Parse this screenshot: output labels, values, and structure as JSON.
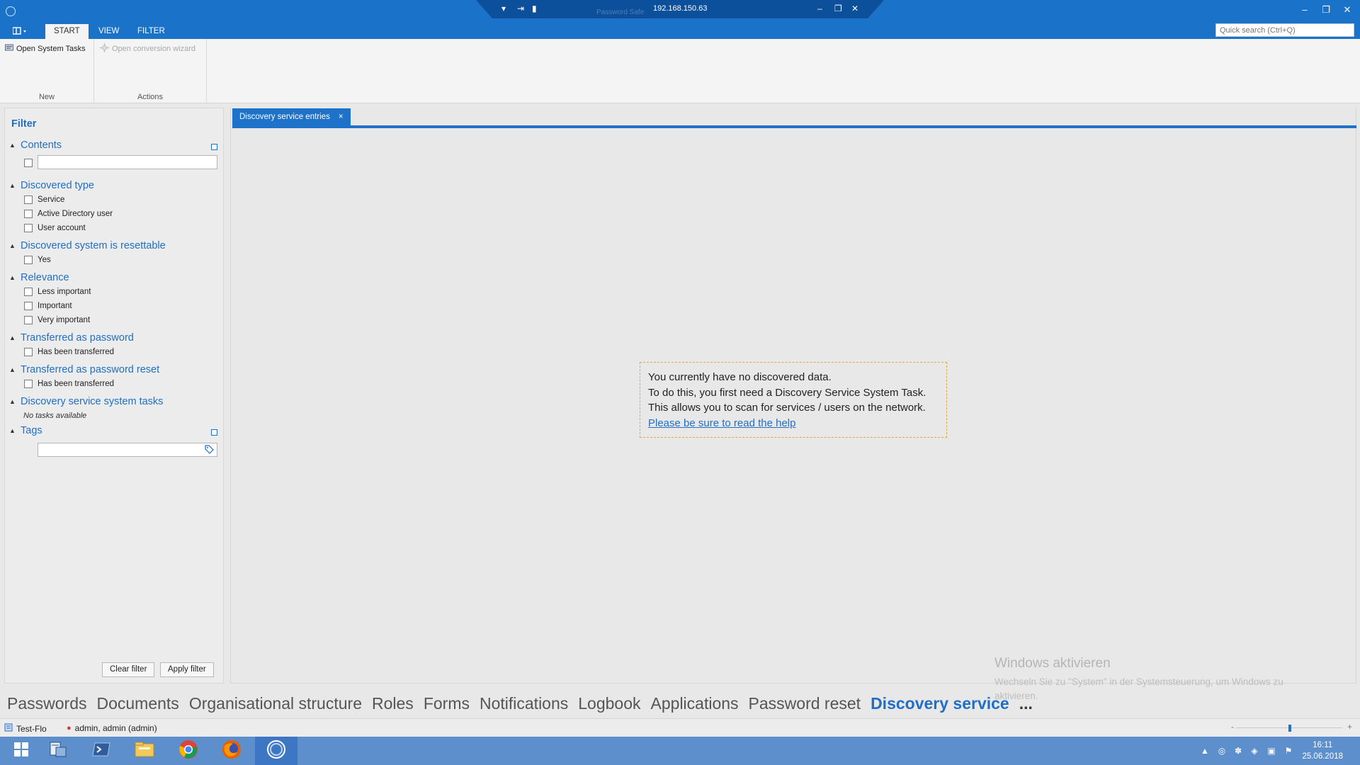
{
  "titlebar": {
    "rdp_ip": "192.168.150.63",
    "rdp_subtitle": "Password Safe",
    "controls": {
      "minimize": "–",
      "restore": "❐",
      "close": "✕"
    }
  },
  "ribbon": {
    "tabs": [
      {
        "label": "START",
        "active": true
      },
      {
        "label": "VIEW",
        "active": false
      },
      {
        "label": "FILTER",
        "active": false
      }
    ],
    "quick_search_placeholder": "Quick search (Ctrl+Q)",
    "groups": {
      "new": {
        "label": "New",
        "open_system_tasks": "Open System Tasks"
      },
      "actions": {
        "label": "Actions",
        "open_conversion_wizard": "Open conversion wizard"
      }
    }
  },
  "filter": {
    "title": "Filter",
    "sections": {
      "contents": {
        "title": "Contents"
      },
      "discovered_type": {
        "title": "Discovered type",
        "options": [
          "Service",
          "Active Directory user",
          "User account"
        ]
      },
      "resettable": {
        "title": "Discovered system is resettable",
        "options": [
          "Yes"
        ]
      },
      "relevance": {
        "title": "Relevance",
        "options": [
          "Less important",
          "Important",
          "Very important"
        ]
      },
      "transferred_password": {
        "title": "Transferred as password",
        "options": [
          "Has been transferred"
        ]
      },
      "transferred_reset": {
        "title": "Transferred as password reset",
        "options": [
          "Has been transferred"
        ]
      },
      "system_tasks": {
        "title": "Discovery service system tasks",
        "empty_text": "No tasks available"
      },
      "tags": {
        "title": "Tags"
      }
    },
    "buttons": {
      "clear": "Clear filter",
      "apply": "Apply filter"
    }
  },
  "document": {
    "tab_label": "Discovery service entries",
    "tab_close": "×",
    "info_lines": [
      "You currently have no discovered data.",
      "To do this, you first need a Discovery Service System Task.",
      "This allows you to scan for services / users on the network."
    ],
    "help_link": "Please be sure to read the help"
  },
  "watermark": {
    "title": "Windows aktivieren",
    "subtitle": "Wechseln Sie zu \"System\" in der Systemsteuerung, um Windows zu aktivieren."
  },
  "bottom_nav": {
    "items": [
      "Passwords",
      "Documents",
      "Organisational structure",
      "Roles",
      "Forms",
      "Notifications",
      "Logbook",
      "Applications",
      "Password reset",
      "Discovery service"
    ],
    "active": "Discovery service",
    "more": "..."
  },
  "status_bar": {
    "database": "Test-Flo",
    "user": "admin, admin (admin)",
    "zoom_minus": "-",
    "zoom_plus": "+"
  },
  "taskbar": {
    "clock_time": "16:11",
    "clock_date": "25.06.2018"
  },
  "colors": {
    "accent": "#1f6fc5",
    "titlebar": "#1a73c8",
    "taskbar": "#5d8fcd",
    "info_border": "#e0a64c"
  }
}
